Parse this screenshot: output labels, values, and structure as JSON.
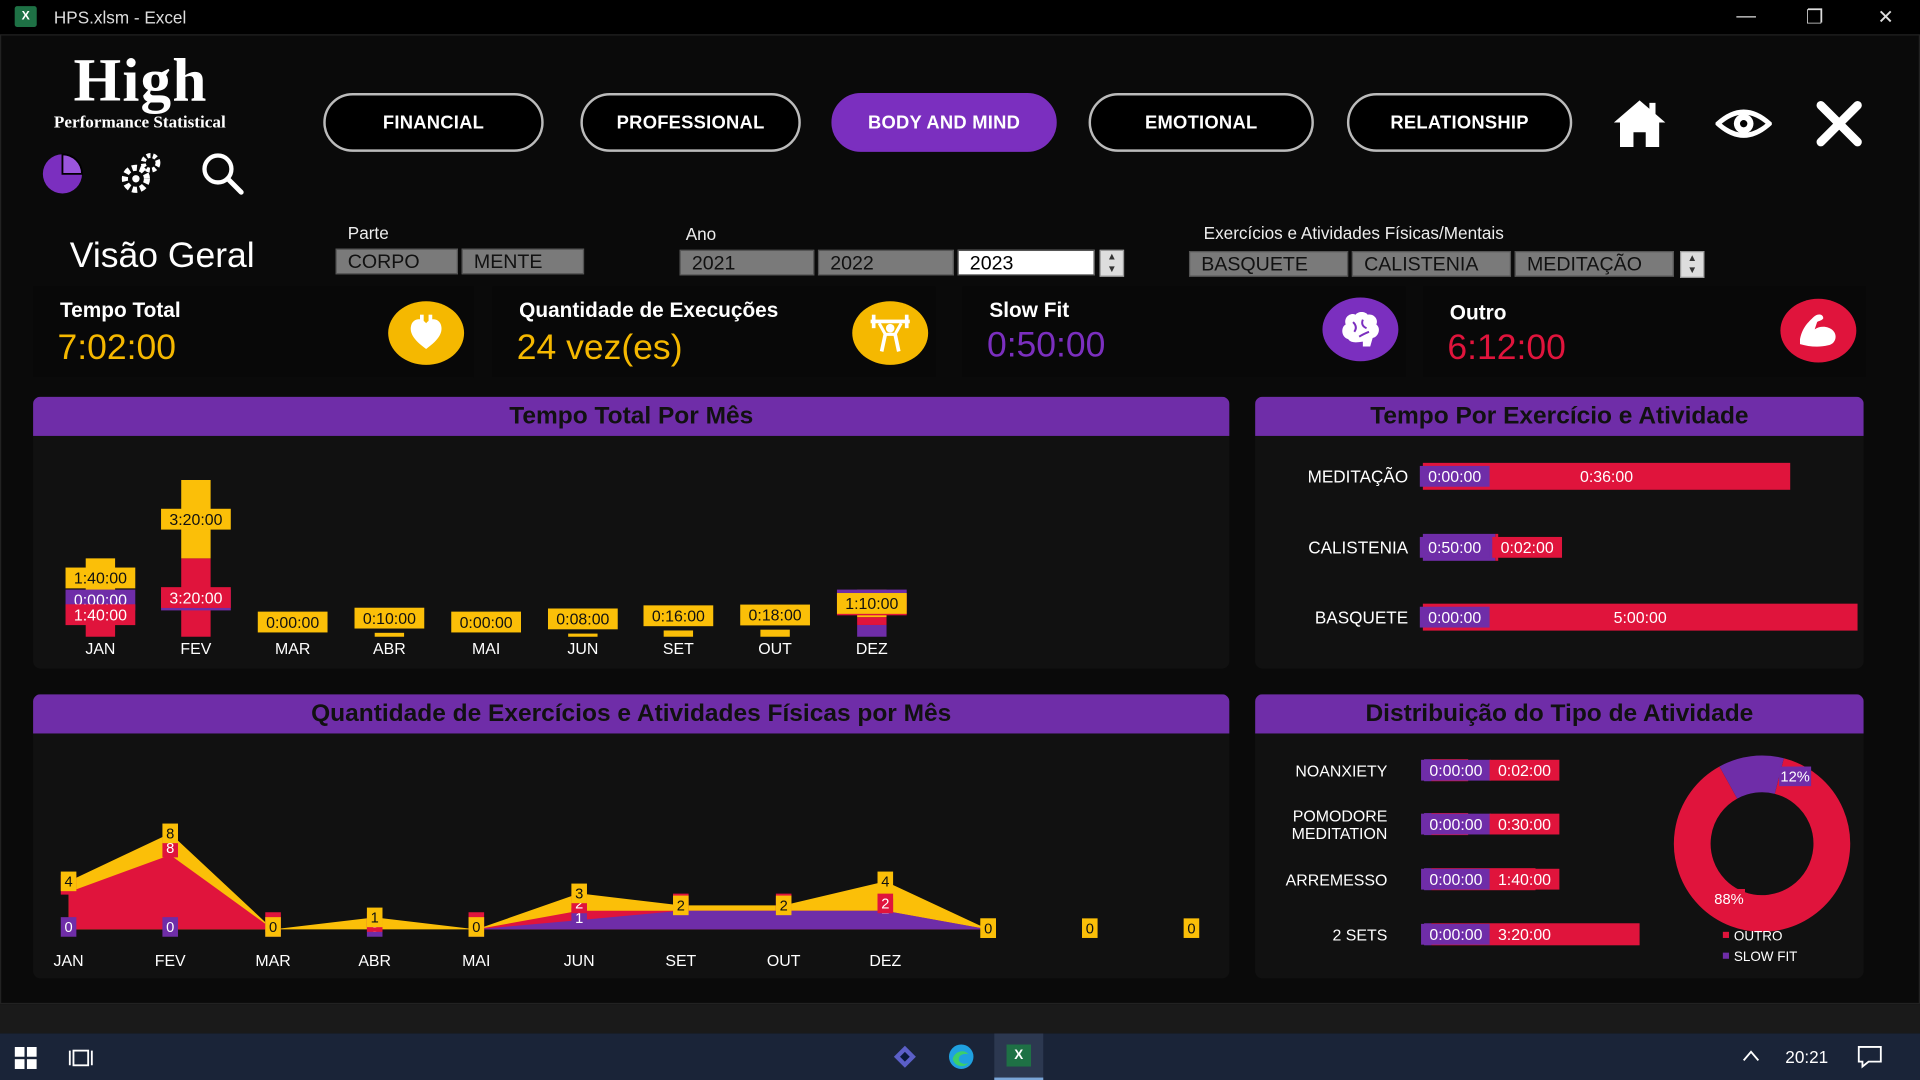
{
  "window": {
    "title": "HPS.xlsm - Excel",
    "minimize": "—",
    "restore": "❐",
    "close": "✕"
  },
  "logo": {
    "title": "High",
    "subtitle": "Performance Statistical"
  },
  "nav": [
    "FINANCIAL",
    "PROFESSIONAL",
    "BODY AND MIND",
    "EMOTIONAL",
    "RELATIONSHIP"
  ],
  "nav_active": "BODY AND MIND",
  "filters": {
    "heading": "Visão Geral",
    "parte_label": "Parte",
    "parte": [
      "CORPO",
      "MENTE"
    ],
    "ano_label": "Ano",
    "ano": [
      "2021",
      "2022",
      "2023"
    ],
    "ano_selected": "2023",
    "exercicios_label": "Exercícios e Atividades Físicas/Mentais",
    "exercicios": [
      "BASQUETE",
      "CALISTENIA",
      "MEDITAÇÃO"
    ]
  },
  "kpis": [
    {
      "title": "Tempo Total",
      "value": "7:02:00",
      "color": "#f5b800",
      "icon": "heart-icon"
    },
    {
      "title": "Quantidade de Execuções",
      "value": "24 vez(es)",
      "color": "#f5b800",
      "icon": "weightlifter-icon"
    },
    {
      "title": "Slow Fit",
      "value": "0:50:00",
      "color": "#7b2fbf",
      "icon": "brain-icon"
    },
    {
      "title": "Outro",
      "value": "6:12:00",
      "color": "#e0143c",
      "icon": "muscle-icon"
    }
  ],
  "colors": {
    "purple": "#6f2da8",
    "red": "#e0143c",
    "yellow": "#fbbf08"
  },
  "panels": {
    "tempo_mes": "Tempo Total Por Mês",
    "tempo_exercicio": "Tempo Por Exercício e Atividade",
    "quantidade_mes": "Quantidade de Exercícios e Atividades Físicas por Mês",
    "distribuicao": "Distribuição do Tipo de Atividade"
  },
  "chart_data": [
    {
      "type": "bar",
      "title": "Tempo Total Por Mês",
      "stacked": true,
      "categories": [
        "JAN",
        "FEV",
        "MAR",
        "ABR",
        "MAI",
        "JUN",
        "SET",
        "OUT",
        "DEZ"
      ],
      "series": [
        {
          "values": [
            "0:00:00",
            "0:00:00",
            null,
            null,
            null,
            null,
            null,
            null,
            "0:30:00"
          ],
          "color": "#6f2da8"
        },
        {
          "values": [
            "1:40:00",
            "3:20:00",
            null,
            null,
            null,
            null,
            null,
            null,
            "0:20:00"
          ],
          "color": "#e0143c"
        },
        {
          "values": [
            "1:40:00",
            "3:20:00",
            "0:00:00",
            "0:10:00",
            "0:00:00",
            "0:08:00",
            "0:16:00",
            "0:18:00",
            "1:10:00"
          ],
          "color": "#fbbf08"
        }
      ]
    },
    {
      "type": "bar",
      "title": "Tempo Por Exercício e Atividade",
      "orientation": "horizontal",
      "categories": [
        "MEDITAÇÃO",
        "CALISTENIA",
        "BASQUETE"
      ],
      "series": [
        {
          "values": [
            "0:00:00",
            "0:50:00",
            "0:00:00"
          ],
          "color": "#6f2da8"
        },
        {
          "values": [
            "0:36:00",
            "0:02:00",
            "5:00:00"
          ],
          "color": "#e0143c"
        }
      ]
    },
    {
      "type": "area",
      "title": "Quantidade de Exercícios e Atividades Físicas por Mês",
      "stacked": true,
      "categories": [
        "JAN",
        "FEV",
        "MAR",
        "ABR",
        "MAI",
        "JUN",
        "SET",
        "OUT",
        "DEZ"
      ],
      "series": [
        {
          "values": [
            0,
            0,
            0,
            0,
            0,
            1,
            2,
            2,
            2
          ],
          "color": "#6f2da8"
        },
        {
          "values": [
            4,
            8,
            0,
            0,
            0,
            2,
            2,
            2,
            2
          ],
          "color": "#e0143c"
        },
        {
          "values": [
            4,
            8,
            0,
            1,
            0,
            3,
            2,
            2,
            4
          ],
          "color": "#fbbf08"
        }
      ],
      "extra_labels": [
        "0",
        "0",
        "0",
        "0"
      ]
    },
    {
      "type": "bar",
      "title": "Distribuição do Tipo de Atividade",
      "orientation": "horizontal",
      "categories": [
        "NOANXIETY",
        "POMODORE MEDITATION",
        "ARREMESSO",
        "2 SETS"
      ],
      "series": [
        {
          "values": [
            "0:00:00",
            "0:00:00",
            "0:00:00",
            "0:00:00"
          ],
          "color": "#6f2da8"
        },
        {
          "values": [
            "0:02:00",
            "0:30:00",
            "1:40:00",
            "3:20:00"
          ],
          "color": "#e0143c"
        }
      ]
    },
    {
      "type": "pie",
      "donut": true,
      "labels": [
        "OUTRO",
        "SLOW FIT"
      ],
      "values": [
        88,
        12
      ],
      "value_labels": [
        "88%",
        "12%"
      ],
      "colors": [
        "#e0143c",
        "#6f2da8"
      ],
      "legend": "bottom-right"
    }
  ],
  "taskbar": {
    "time": "20:21"
  }
}
